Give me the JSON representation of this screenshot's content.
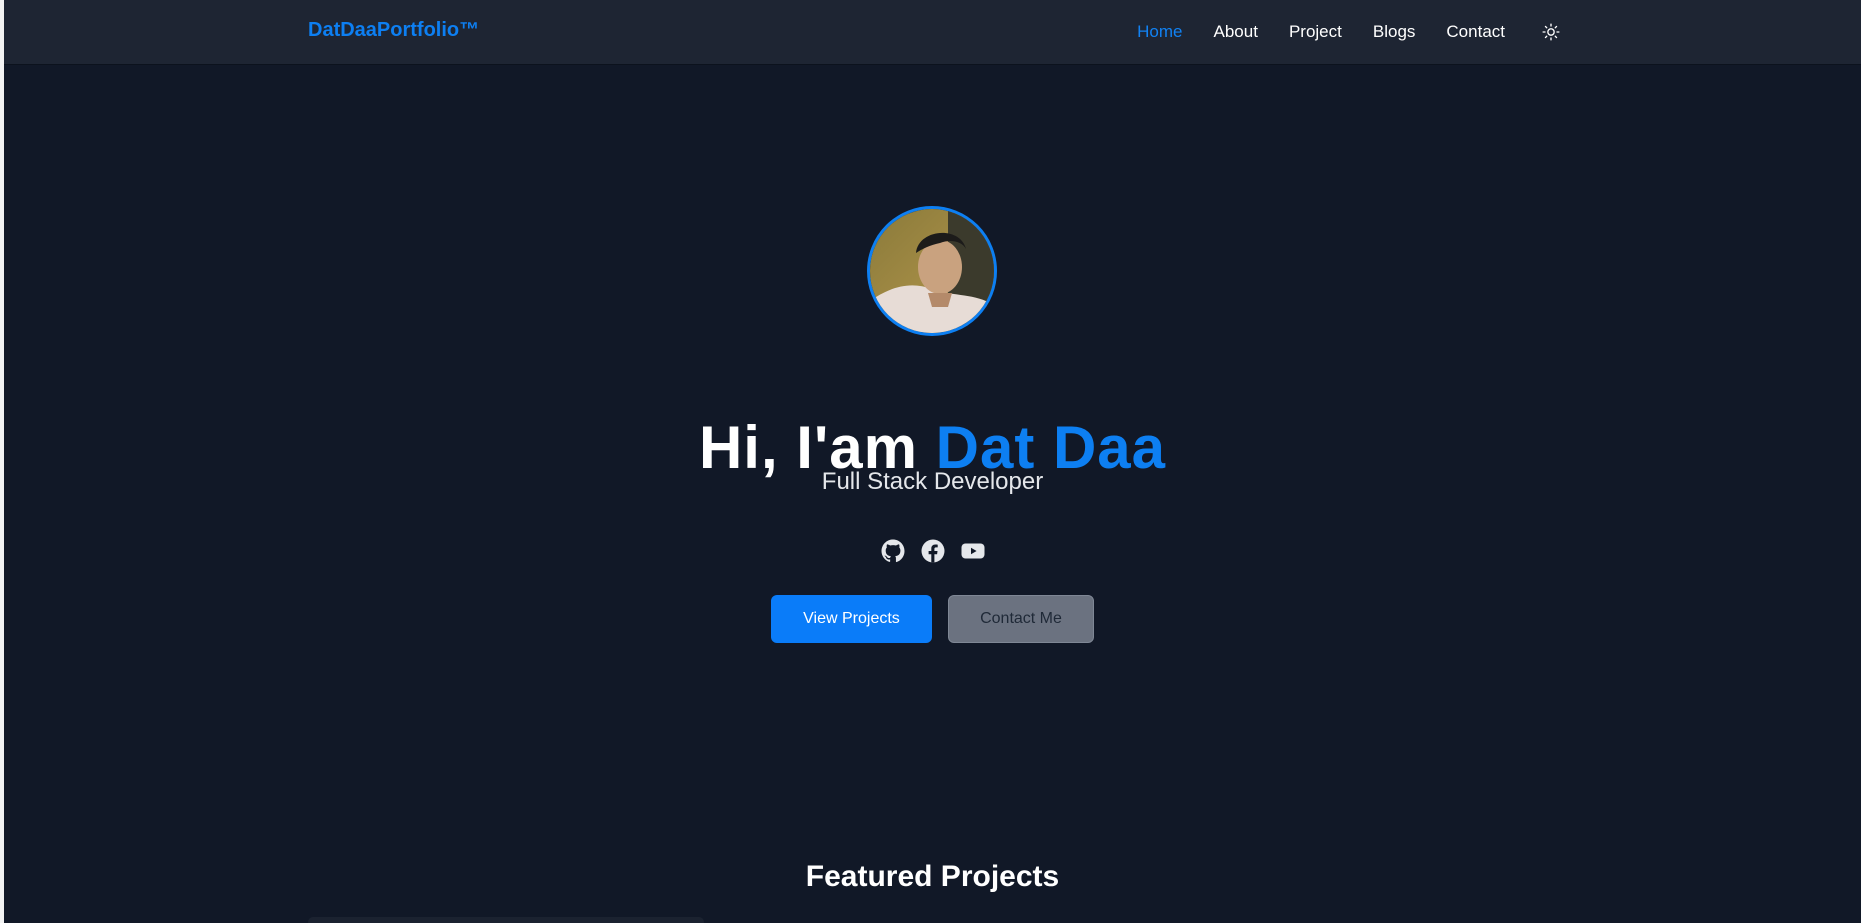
{
  "navbar": {
    "brand": "DatDaaPortfolio™",
    "links": [
      {
        "label": "Home",
        "active": true
      },
      {
        "label": "About",
        "active": false
      },
      {
        "label": "Project",
        "active": false
      },
      {
        "label": "Blogs",
        "active": false
      },
      {
        "label": "Contact",
        "active": false
      }
    ],
    "theme_toggle_icon": "sun-icon"
  },
  "hero": {
    "greeting": "Hi, I'am ",
    "name": "Dat Daa",
    "subtitle": "Full Stack Developer",
    "socials": [
      "github-icon",
      "facebook-icon",
      "youtube-icon"
    ],
    "primary_button": "View Projects",
    "secondary_button": "Contact Me"
  },
  "featured": {
    "title": "Featured Projects"
  },
  "colors": {
    "accent": "#0d7ff2",
    "background": "#111827",
    "navbar": "#1e2533",
    "secondary_button": "#6b7280"
  }
}
